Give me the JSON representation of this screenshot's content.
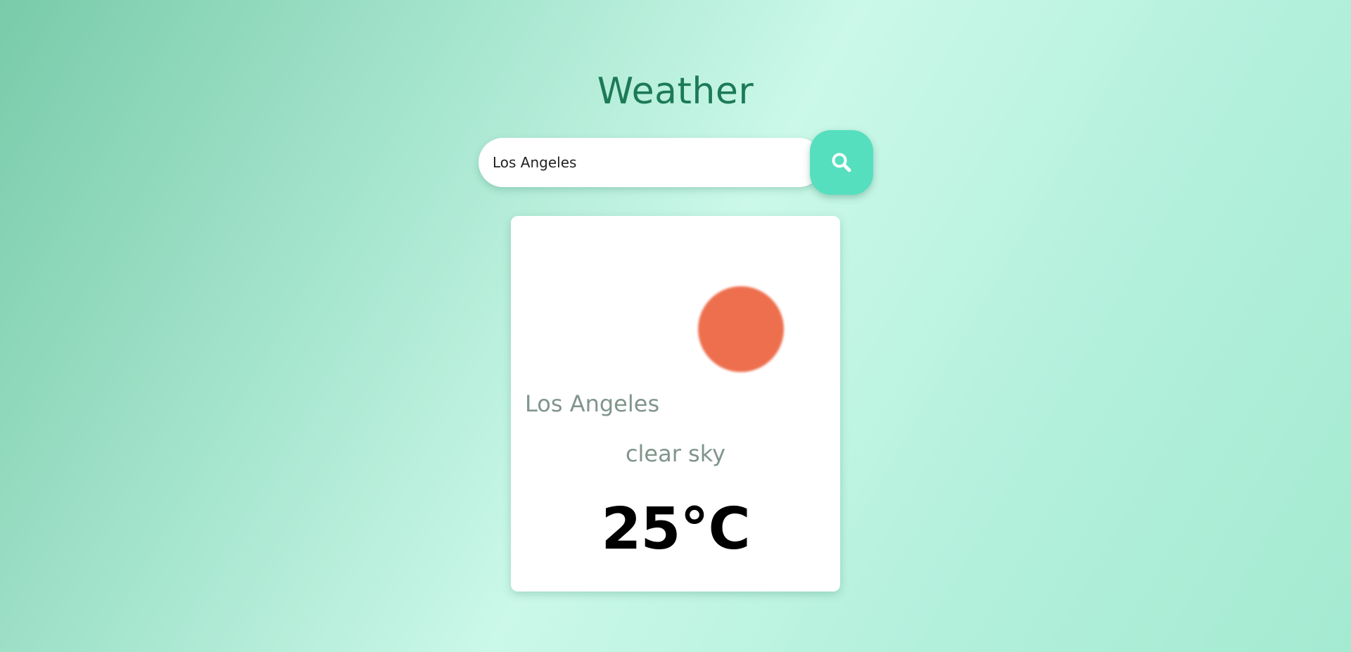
{
  "app": {
    "title": "Weather"
  },
  "search": {
    "value": "Los Angeles",
    "placeholder": "",
    "button_icon": "search-icon"
  },
  "weather": {
    "city": "Los Angeles",
    "description": "clear sky",
    "temperature": "25°C",
    "icon": "sun-icon"
  },
  "colors": {
    "title": "#1c7a57",
    "accent": "#56dfbf",
    "sun": "#ee6f4e",
    "muted_text": "#80958c",
    "card": "#ffffff"
  }
}
